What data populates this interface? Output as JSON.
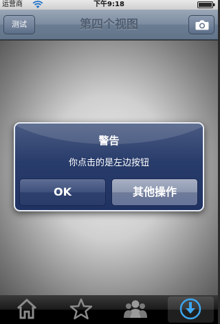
{
  "status_bar": {
    "carrier": "运营商",
    "time": "下午9:18"
  },
  "nav_bar": {
    "title": "第四个视图",
    "left_button": "测试",
    "right_icon": "camera-icon"
  },
  "alert": {
    "title": "警告",
    "message": "你点击的是左边按钮",
    "buttons": [
      "OK",
      "其他操作"
    ]
  },
  "tab_bar": {
    "items": [
      {
        "icon": "home-icon"
      },
      {
        "icon": "star-icon"
      },
      {
        "icon": "people-icon"
      },
      {
        "icon": "download-icon",
        "selected": true
      }
    ]
  },
  "colors": {
    "alert_bg": "#283c6b",
    "nav_bar": "#7c8ca0"
  }
}
